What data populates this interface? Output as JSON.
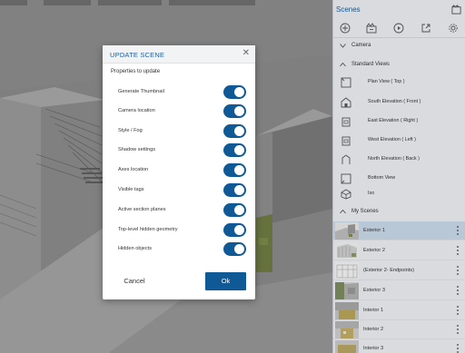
{
  "sidebar": {
    "title": "Scenes",
    "toolbar_icons": [
      "add-scene-icon",
      "update-scene-icon",
      "play-icon",
      "export-icon",
      "settings-icon"
    ],
    "camera_label": "Camera",
    "standard_views_label": "Standard Views",
    "views": [
      {
        "label": "Plan View ( Top )",
        "icon": "plan-view-icon"
      },
      {
        "label": "South Elevation ( Front )",
        "icon": "south-elevation-icon"
      },
      {
        "label": "East Elevation ( Right )",
        "icon": "east-elevation-icon"
      },
      {
        "label": "West Elevation ( Left )",
        "icon": "west-elevation-icon"
      },
      {
        "label": "North Elevation ( Back )",
        "icon": "north-elevation-icon"
      },
      {
        "label": "Bottom View",
        "icon": "bottom-view-icon"
      },
      {
        "label": "Iso",
        "icon": "iso-view-icon"
      }
    ],
    "my_scenes_label": "My Scenes",
    "scenes": [
      {
        "label": "Exterior 1",
        "selected": true
      },
      {
        "label": "Exterior 2",
        "selected": false
      },
      {
        "label": "(Exterior 2- Endpoints)",
        "selected": false
      },
      {
        "label": "Exterior 3",
        "selected": false
      },
      {
        "label": "Interior 1",
        "selected": false
      },
      {
        "label": "Interior 2",
        "selected": false
      },
      {
        "label": "Interior 3",
        "selected": false
      }
    ]
  },
  "dialog": {
    "title": "UPDATE SCENE",
    "subtitle": "Properties to update",
    "options": [
      {
        "label": "Generate Thumbnail",
        "on": true
      },
      {
        "label": "Camera location",
        "on": true
      },
      {
        "label": "Style / Fog",
        "on": true
      },
      {
        "label": "Shadow settings",
        "on": true
      },
      {
        "label": "Axes location",
        "on": true
      },
      {
        "label": "Visible tags",
        "on": true
      },
      {
        "label": "Active section planes",
        "on": true
      },
      {
        "label": "Top-level hidden geometry",
        "on": true
      },
      {
        "label": "Hidden objects",
        "on": true
      }
    ],
    "cancel_label": "Cancel",
    "ok_label": "Ok"
  },
  "colors": {
    "accent": "#0f5a96",
    "title_blue": "#1c5fa0",
    "selected_row": "#c9d9ea"
  }
}
